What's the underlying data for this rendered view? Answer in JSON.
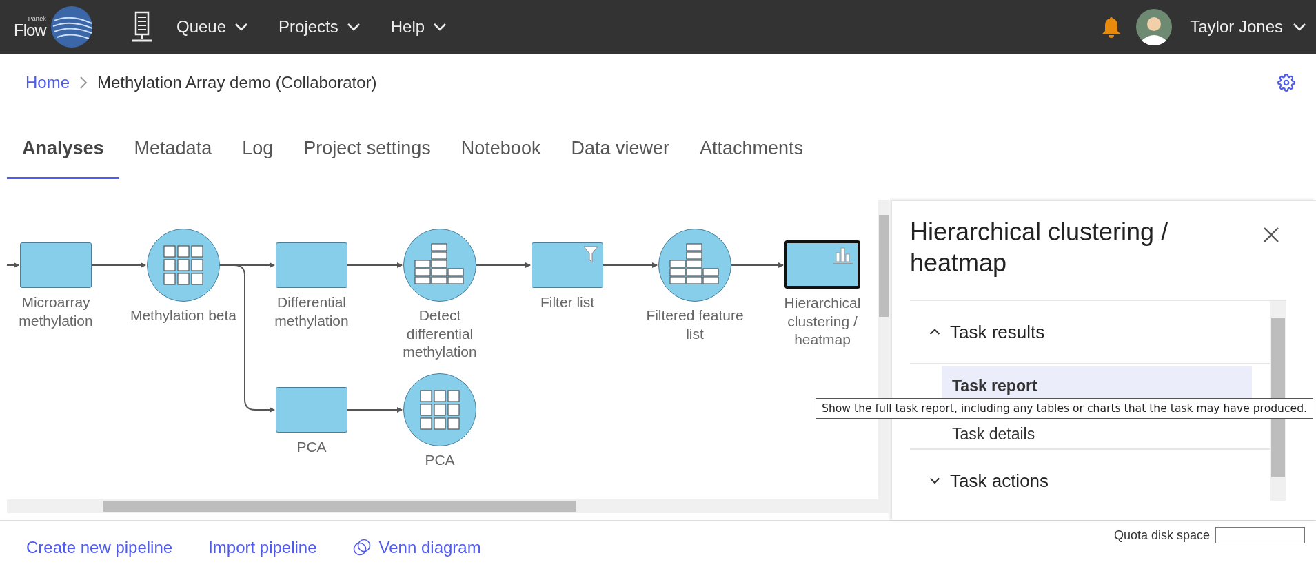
{
  "header": {
    "logo": {
      "small": "Partek",
      "name": "Flow"
    },
    "menus": [
      {
        "label": "Queue"
      },
      {
        "label": "Projects"
      },
      {
        "label": "Help"
      }
    ],
    "user": "Taylor Jones"
  },
  "breadcrumb": [
    {
      "label": "Home",
      "kind": "link"
    },
    {
      "label": "Methylation Array demo (Collaborator)",
      "kind": "current"
    }
  ],
  "tabs": [
    {
      "label": "Analyses",
      "selected": true
    },
    {
      "label": "Metadata",
      "selected": false
    },
    {
      "label": "Log",
      "selected": false
    },
    {
      "label": "Project settings",
      "selected": false
    },
    {
      "label": "Notebook",
      "selected": false
    },
    {
      "label": "Data viewer",
      "selected": false
    },
    {
      "label": "Attachments",
      "selected": false
    }
  ],
  "pipeline": {
    "nodes": [
      {
        "kind": "task",
        "label": "Microarray methylation",
        "selected": false
      },
      {
        "kind": "data",
        "label": "Methylation beta",
        "selected": false
      },
      {
        "kind": "task",
        "label": "Differential methylation",
        "selected": false
      },
      {
        "kind": "data",
        "label": "Detect differential methylation",
        "selected": false
      },
      {
        "kind": "task",
        "label": "Filter list",
        "selected": false
      },
      {
        "kind": "data",
        "label": "Filtered feature list",
        "selected": false
      },
      {
        "kind": "task",
        "label": "Hierarchical clustering / heatmap",
        "selected": true
      },
      {
        "kind": "task",
        "label": "PCA",
        "selected": false
      },
      {
        "kind": "data",
        "label": "PCA",
        "selected": false
      }
    ]
  },
  "panel": {
    "title": "Hierarchical clustering / heatmap",
    "sections": [
      {
        "label": "Task results",
        "expanded": true,
        "items": [
          {
            "label": "Task report",
            "selected": true
          },
          {
            "label": "Task details",
            "selected": false
          }
        ]
      },
      {
        "label": "Task actions",
        "expanded": false
      }
    ]
  },
  "tooltip": "Show the full task report, including any tables or charts that the task may have produced.",
  "footer": {
    "links": [
      {
        "label": "Create new pipeline"
      },
      {
        "label": "Import pipeline"
      },
      {
        "label": "Venn diagram"
      }
    ],
    "quota": {
      "label": "Quota disk space"
    }
  }
}
